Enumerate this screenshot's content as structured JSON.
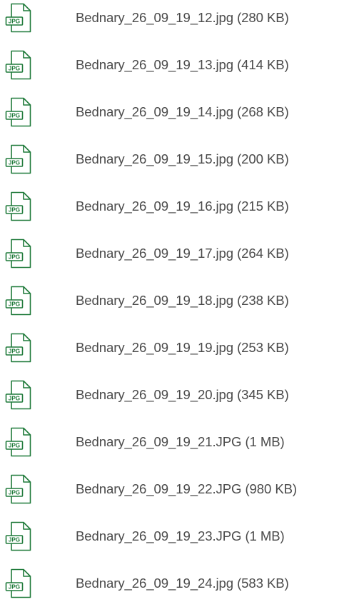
{
  "icon_color": "#1f7a3a",
  "text_color": "#4a4a4a",
  "files": [
    {
      "icon": "jpg-file-icon",
      "badge": "JPG",
      "label": "Bednary_26_09_19_12.jpg (280 KB)"
    },
    {
      "icon": "jpg-file-icon",
      "badge": "JPG",
      "label": "Bednary_26_09_19_13.jpg (414 KB)"
    },
    {
      "icon": "jpg-file-icon",
      "badge": "JPG",
      "label": "Bednary_26_09_19_14.jpg (268 KB)"
    },
    {
      "icon": "jpg-file-icon",
      "badge": "JPG",
      "label": "Bednary_26_09_19_15.jpg (200 KB)"
    },
    {
      "icon": "jpg-file-icon",
      "badge": "JPG",
      "label": "Bednary_26_09_19_16.jpg (215 KB)"
    },
    {
      "icon": "jpg-file-icon",
      "badge": "JPG",
      "label": "Bednary_26_09_19_17.jpg (264 KB)"
    },
    {
      "icon": "jpg-file-icon",
      "badge": "JPG",
      "label": "Bednary_26_09_19_18.jpg (238 KB)"
    },
    {
      "icon": "jpg-file-icon",
      "badge": "JPG",
      "label": "Bednary_26_09_19_19.jpg (253 KB)"
    },
    {
      "icon": "jpg-file-icon",
      "badge": "JPG",
      "label": "Bednary_26_09_19_20.jpg (345 KB)"
    },
    {
      "icon": "jpg-file-icon",
      "badge": "JPG",
      "label": "Bednary_26_09_19_21.JPG (1 MB)"
    },
    {
      "icon": "jpg-file-icon",
      "badge": "JPG",
      "label": "Bednary_26_09_19_22.JPG (980 KB)"
    },
    {
      "icon": "jpg-file-icon",
      "badge": "JPG",
      "label": "Bednary_26_09_19_23.JPG (1 MB)"
    },
    {
      "icon": "jpg-file-icon",
      "badge": "JPG",
      "label": "Bednary_26_09_19_24.jpg (583 KB)"
    }
  ]
}
